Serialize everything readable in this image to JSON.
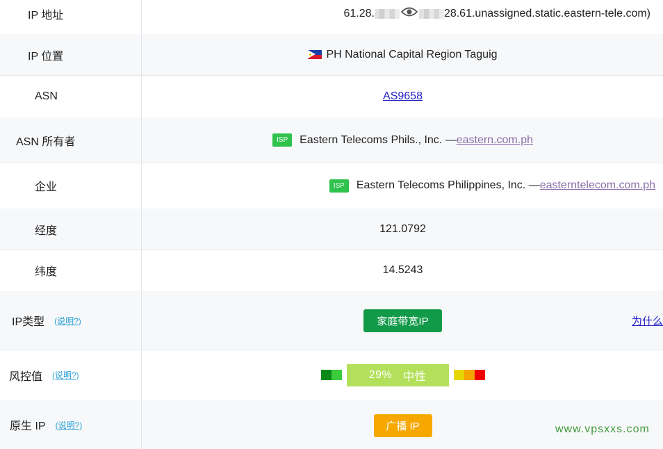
{
  "rows": {
    "ip_address": {
      "label": "IP 地址",
      "prefix": "61.28.",
      "suffix": "28.61.unassigned.static.eastern-tele.com)"
    },
    "ip_location": {
      "label": "IP 位置",
      "value": "PH National Capital Region Taguig"
    },
    "asn": {
      "label": "ASN",
      "value": "AS9658"
    },
    "asn_owner": {
      "label": "ASN 所有者",
      "badge": "ISP",
      "name": "Eastern Telecoms Phils., Inc. —",
      "link": "eastern.com.ph"
    },
    "company": {
      "label": "企业",
      "badge": "ISP",
      "name": "Eastern Telecoms Philippines, Inc. —",
      "link": "easterntelecom.com.ph"
    },
    "longitude": {
      "label": "经度",
      "value": "121.0792"
    },
    "latitude": {
      "label": "纬度",
      "value": "14.5243"
    },
    "ip_type": {
      "label": "IP类型",
      "help": "(说明?)",
      "value": "家庭带宽IP",
      "why": "为什么"
    },
    "risk": {
      "label": "风控值",
      "help": "(说明?)",
      "percent": "29%",
      "level": "中性"
    },
    "native_ip": {
      "label": "原生 IP",
      "help": "(说明?)",
      "value": "广播 IP"
    }
  },
  "colors": {
    "green_button": "#119a48",
    "orange_button": "#f6a800",
    "isp_badge": "#2fc24d",
    "risk_box": "#b3e05a",
    "risk_segments": [
      "#0b8a1a",
      "#3bcc3b",
      "#e6d600",
      "#f5a500",
      "#f20000"
    ]
  },
  "watermark": "www.vpsxxs.com"
}
